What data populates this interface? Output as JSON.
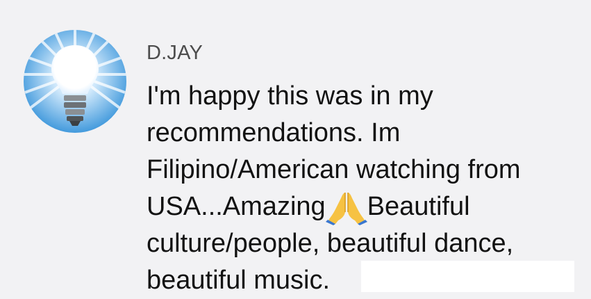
{
  "comment": {
    "author": "D.JAY",
    "avatar_icon": "lightbulb-icon",
    "text_lines": [
      "I'm happy this was in my",
      "recommendations. Im",
      "Filipino/American watching from",
      "USA...Amazing",
      "culture/people, beautiful dance,",
      "beautiful music."
    ],
    "line4_after_emoji": "Beautiful",
    "emoji_icon": "folded-hands-icon"
  },
  "colors": {
    "background": "#f2f2f4",
    "author": "#4d4d4d",
    "text": "#121212",
    "redaction": "#ffffff"
  }
}
